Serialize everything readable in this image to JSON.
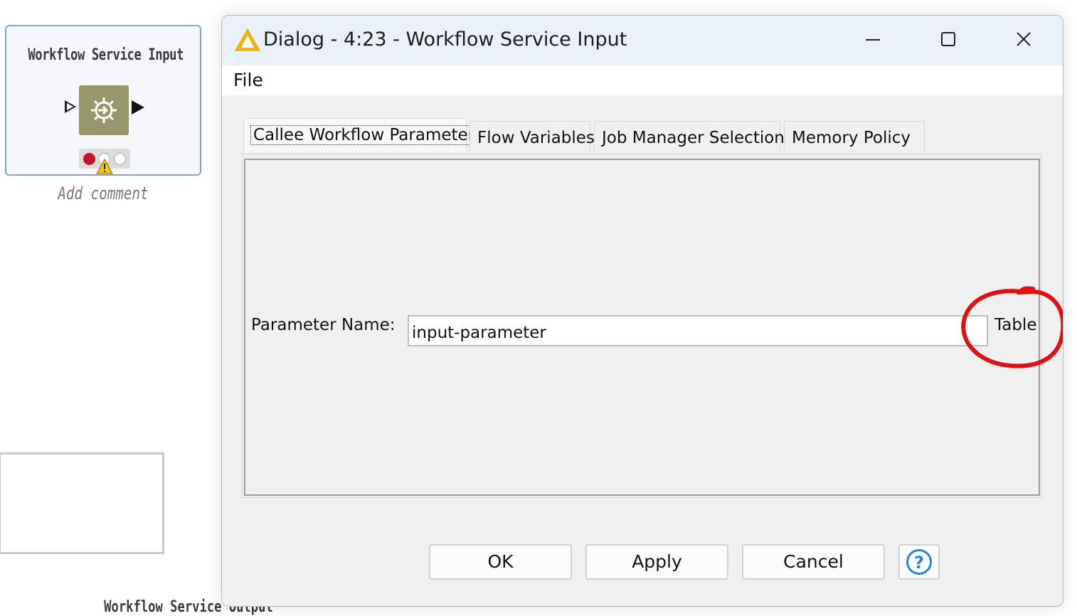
{
  "canvas": {
    "node": {
      "title": "Workflow Service Input",
      "comment_placeholder": "Add comment",
      "status": "error",
      "icon": "node-gear-icon"
    },
    "bottom_node_title": "Workflow Service Output"
  },
  "dialog": {
    "title": "Dialog - 4:23 - Workflow Service Input",
    "title_icon": "warning-triangle-icon",
    "menu": {
      "file": "File"
    },
    "tabs": [
      {
        "label": "Callee Workflow Parameter",
        "active": true
      },
      {
        "label": "Flow Variables",
        "active": false
      },
      {
        "label": "Job Manager Selection",
        "active": false
      },
      {
        "label": "Memory Policy",
        "active": false
      }
    ],
    "form": {
      "parameter_name_label": "Parameter Name:",
      "parameter_name_value": "input-parameter",
      "type_label": "Table"
    },
    "buttons": {
      "ok": "OK",
      "apply": "Apply",
      "cancel": "Cancel",
      "help": "help-icon"
    }
  },
  "colors": {
    "titlebar": "#eaf0f7",
    "node_body": "#98976a",
    "status_red": "#c8102e",
    "warning_yellow": "#f5c518",
    "annotation_red": "#e01010",
    "help_blue": "#1e88e5"
  }
}
